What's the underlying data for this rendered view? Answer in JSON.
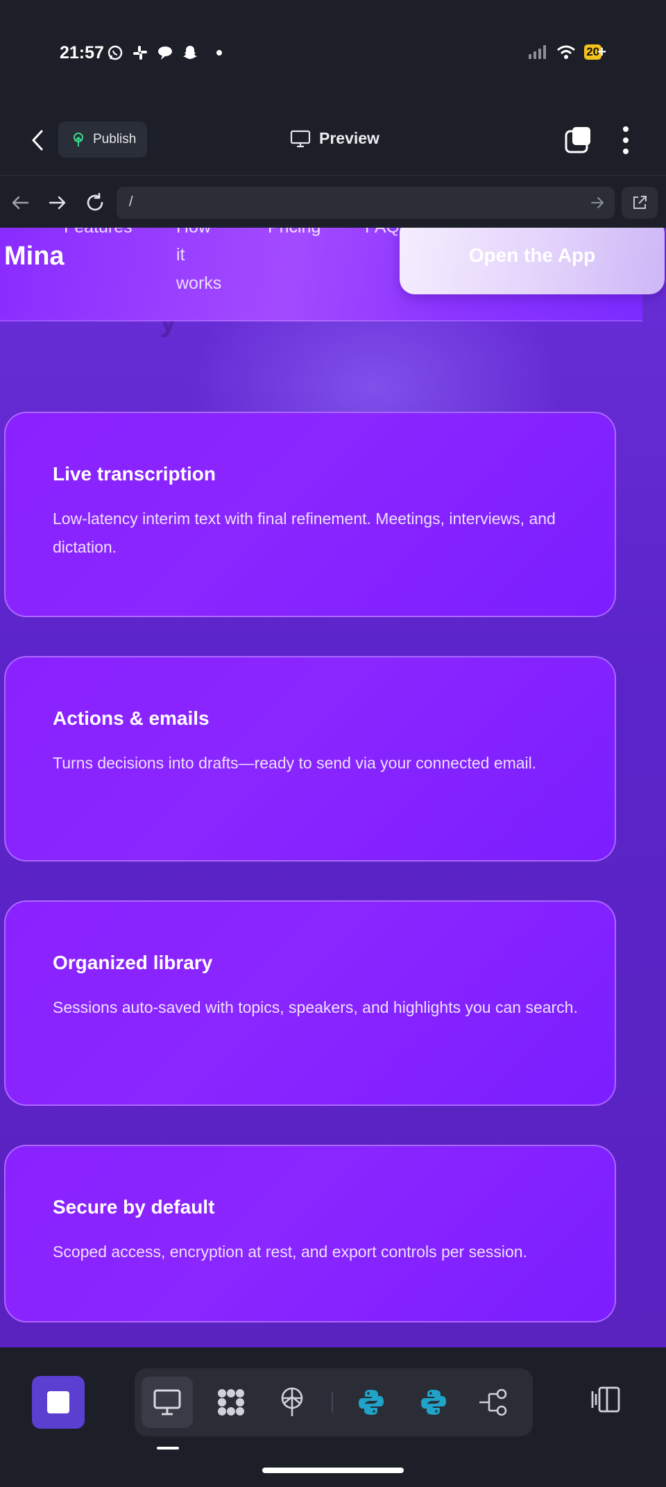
{
  "status_bar": {
    "time": "21:57",
    "battery": "20"
  },
  "toolbar": {
    "publish_label": "Publish",
    "preview_label": "Preview"
  },
  "browser": {
    "url": "/"
  },
  "site": {
    "brand": "Mina",
    "nav": [
      "Features",
      "How",
      "it",
      "works",
      "Pricing",
      "FAQ"
    ],
    "cta_label": "Open the App",
    "section_title_fragment": "y"
  },
  "features": [
    {
      "title": "Live transcription",
      "description": "Low-latency interim text with final refinement. Meetings, interviews, and dictation."
    },
    {
      "title": "Actions & emails",
      "description": "Turns decisions into drafts—ready to send via your connected email."
    },
    {
      "title": "Organized library",
      "description": "Sessions auto-saved with topics, speakers, and highlights you can search."
    },
    {
      "title": "Secure by default",
      "description": "Scoped access, encryption at rest, and export controls per session."
    }
  ],
  "colors": {
    "accent": "#5a3fd0",
    "card": "#8a22ff",
    "page_bg": "#1c1f27"
  }
}
